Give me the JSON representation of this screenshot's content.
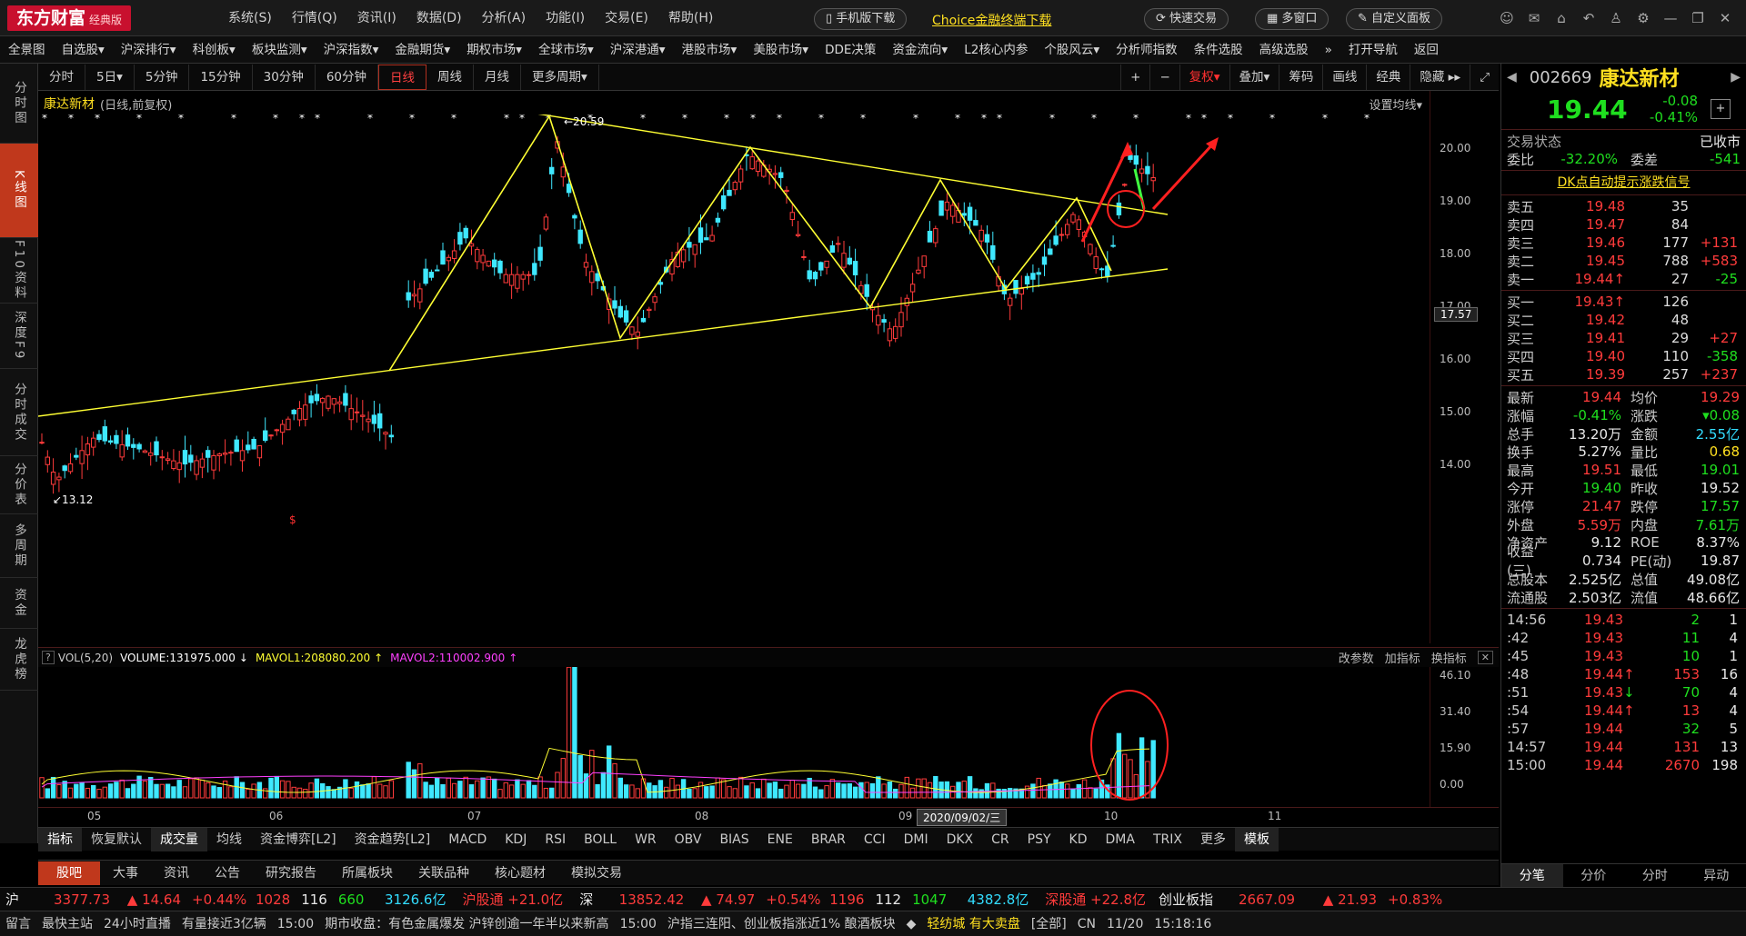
{
  "titlebar": {
    "logo": "东方财富",
    "logo_sub": "经典版",
    "menu": [
      "系统(S)",
      "行情(Q)",
      "资讯(I)",
      "数据(D)",
      "分析(A)",
      "功能(I)",
      "交易(E)",
      "帮助(H)"
    ],
    "mobile_btn": "手机版下载",
    "choice_link": "Choice金融终端下载",
    "quick_trade": "快速交易",
    "multi_window": "多窗口",
    "custom_panel": "自定义面板"
  },
  "navbar": [
    "全景图",
    "自选股▾",
    "沪深排行▾",
    "科创板▾",
    "板块监测▾",
    "沪深指数▾",
    "金融期货▾",
    "期权市场▾",
    "全球市场▾",
    "沪深港通▾",
    "港股市场▾",
    "美股市场▾",
    "DDE决策",
    "资金流向▾",
    "L2核心内参",
    "个股风云▾",
    "分析师指数",
    "条件选股",
    "高级选股",
    "»",
    "打开导航",
    "返回"
  ],
  "lefttabs": [
    {
      "label": "分时图",
      "active": false
    },
    {
      "label": "K线图",
      "active": true
    },
    {
      "label": "F10资料",
      "active": false
    },
    {
      "label": "深度F9",
      "active": false
    },
    {
      "label": "分时成交",
      "active": false
    },
    {
      "label": "分价表",
      "active": false
    },
    {
      "label": "多周期",
      "active": false
    },
    {
      "label": "资金",
      "active": false
    },
    {
      "label": "龙虎榜",
      "active": false
    }
  ],
  "periods": [
    "分时",
    "5日▾",
    "5分钟",
    "15分钟",
    "30分钟",
    "60分钟",
    "日线",
    "周线",
    "月线",
    "更多周期▾"
  ],
  "active_period": "日线",
  "toolbar_right": [
    "+",
    "−",
    "复权▾",
    "叠加▾",
    "筹码",
    "画线",
    "经典",
    "隐藏 ▸▸",
    "⤢"
  ],
  "chart": {
    "title": "康达新材",
    "subtitle": "(日线,前复权)",
    "ma_setting": "设置均线▾",
    "high_label": "20.59",
    "low_label": "13.12",
    "current_label": "17.57"
  },
  "volume_panel": {
    "indicator": "VOL(5,20)",
    "volume_text": "VOLUME:131975.000",
    "mavol1": "MAVOL1:208080.200",
    "mavol2": "MAVOL2:110002.900",
    "actions": [
      "改参数",
      "加指标",
      "换指标"
    ]
  },
  "yaxis_main": [
    "20.00",
    "19.00",
    "18.00",
    "17.00",
    "16.00",
    "15.00",
    "14.00"
  ],
  "yaxis_vol": [
    "46.10",
    "31.40",
    "15.90",
    "0.00"
  ],
  "xaxis": [
    "05",
    "06",
    "07",
    "08",
    "09",
    "10",
    "11"
  ],
  "date_cursor": "2020/09/02/三",
  "indicator_tabs": [
    "指标",
    "恢复默认",
    "成交量",
    "均线",
    "资金博弈[L2]",
    "资金趋势[L2]",
    "MACD",
    "KDJ",
    "RSI",
    "BOLL",
    "WR",
    "OBV",
    "BIAS",
    "ENE",
    "BRAR",
    "CCI",
    "DMI",
    "DKX",
    "CR",
    "PSY",
    "KD",
    "DMA",
    "TRIX",
    "更多",
    "模板"
  ],
  "bottom_tabs": [
    "股吧",
    "大事",
    "资讯",
    "公告",
    "研究报告",
    "所属板块",
    "关联品种",
    "核心题材",
    "模拟交易"
  ],
  "ticker": {
    "sh_label": "沪",
    "sh_value": "3377.73",
    "sh_change": "▲ 14.64",
    "sh_pct": "+0.44%",
    "sh_up": "1028",
    "sh_flat": "116",
    "sh_down": "660",
    "sh_amount": "3126.6亿",
    "hgt": "沪股通 +21.0亿",
    "sz_label": "深",
    "sz_value": "13852.42",
    "sz_change": "▲ 74.97",
    "sz_pct": "+0.54%",
    "sz_up": "1196",
    "sz_flat": "112",
    "sz_down": "1047",
    "sz_amount": "4382.8亿",
    "sgt": "深股通 +22.8亿",
    "cy_label": "创业板指",
    "cy_value": "2667.09",
    "cy_change": "▲ 21.93",
    "cy_pct": "+0.83%"
  },
  "newsbar": [
    "留言",
    "最快主站",
    "24小时直播",
    "有量接近3亿辆",
    "15:00",
    "期市收盘：有色金属爆发 沪锌创逾一年半以来新高",
    "15:00",
    "沪指三连阳、创业板指涨近1% 酿酒板块",
    "◆",
    "轻纺城 有大卖盘",
    "[全部]",
    "CN",
    "11/20",
    "15:18:16"
  ],
  "stock": {
    "code": "002669",
    "name": "康达新材",
    "price": "19.44",
    "change": "-0.08",
    "pct": "-0.41%",
    "trade_status_label": "交易状态",
    "trade_status": "已收市",
    "weibi_label": "委比",
    "weibi": "-32.20%",
    "weicha_label": "委差",
    "weicha": "-541",
    "dk_signal": "DK点自动提示涨跌信号"
  },
  "asks": [
    {
      "label": "卖五",
      "price": "19.48",
      "vol": "35",
      "chg": ""
    },
    {
      "label": "卖四",
      "price": "19.47",
      "vol": "84",
      "chg": ""
    },
    {
      "label": "卖三",
      "price": "19.46",
      "vol": "177",
      "chg": "+131"
    },
    {
      "label": "卖二",
      "price": "19.45",
      "vol": "788",
      "chg": "+583"
    },
    {
      "label": "卖一",
      "price": "19.44↑",
      "vol": "27",
      "chg": "-25"
    }
  ],
  "bids": [
    {
      "label": "买一",
      "price": "19.43↑",
      "vol": "126",
      "chg": ""
    },
    {
      "label": "买二",
      "price": "19.42",
      "vol": "48",
      "chg": ""
    },
    {
      "label": "买三",
      "price": "19.41",
      "vol": "29",
      "chg": "+27"
    },
    {
      "label": "买四",
      "price": "19.40",
      "vol": "110",
      "chg": "-358"
    },
    {
      "label": "买五",
      "price": "19.39",
      "vol": "257",
      "chg": "+237"
    }
  ],
  "quote": [
    {
      "l1": "最新",
      "v1": "19.44",
      "c1": "red",
      "l2": "均价",
      "v2": "19.29",
      "c2": "red"
    },
    {
      "l1": "涨幅",
      "v1": "-0.41%",
      "c1": "green",
      "l2": "涨跌",
      "v2": "▾0.08",
      "c2": "green"
    },
    {
      "l1": "总手",
      "v1": "13.20万",
      "c1": "white",
      "l2": "金额",
      "v2": "2.55亿",
      "c2": "cyan"
    },
    {
      "l1": "换手",
      "v1": "5.27%",
      "c1": "white",
      "l2": "量比",
      "v2": "0.68",
      "c2": "yellow"
    },
    {
      "l1": "最高",
      "v1": "19.51",
      "c1": "red",
      "l2": "最低",
      "v2": "19.01",
      "c2": "green"
    },
    {
      "l1": "今开",
      "v1": "19.40",
      "c1": "green",
      "l2": "昨收",
      "v2": "19.52",
      "c2": "white"
    },
    {
      "l1": "涨停",
      "v1": "21.47",
      "c1": "red",
      "l2": "跌停",
      "v2": "17.57",
      "c2": "green"
    },
    {
      "l1": "外盘",
      "v1": "5.59万",
      "c1": "red",
      "l2": "内盘",
      "v2": "7.61万",
      "c2": "green"
    },
    {
      "l1": "净资产",
      "v1": "9.12",
      "c1": "white",
      "l2": "ROE",
      "v2": "8.37%",
      "c2": "white"
    },
    {
      "l1": "收益(三)",
      "v1": "0.734",
      "c1": "white",
      "l2": "PE(动)",
      "v2": "19.87",
      "c2": "white"
    },
    {
      "l1": "总股本",
      "v1": "2.525亿",
      "c1": "white",
      "l2": "总值",
      "v2": "49.08亿",
      "c2": "white"
    },
    {
      "l1": "流通股",
      "v1": "2.503亿",
      "c1": "white",
      "l2": "流值",
      "v2": "48.66亿",
      "c2": "white"
    }
  ],
  "ticks": [
    {
      "time": "14:56",
      "price": "19.43",
      "arrow": "",
      "vol": "2",
      "n": "1",
      "pc": "red",
      "vc": "green"
    },
    {
      "time": ":42",
      "price": "19.43",
      "arrow": "",
      "vol": "11",
      "n": "4",
      "pc": "red",
      "vc": "green"
    },
    {
      "time": ":45",
      "price": "19.43",
      "arrow": "",
      "vol": "10",
      "n": "1",
      "pc": "red",
      "vc": "green"
    },
    {
      "time": ":48",
      "price": "19.44",
      "arrow": "↑",
      "vol": "153",
      "n": "16",
      "pc": "red",
      "vc": "red"
    },
    {
      "time": ":51",
      "price": "19.43",
      "arrow": "↓",
      "vol": "70",
      "n": "4",
      "pc": "red",
      "vc": "green"
    },
    {
      "time": ":54",
      "price": "19.44",
      "arrow": "↑",
      "vol": "13",
      "n": "4",
      "pc": "red",
      "vc": "red"
    },
    {
      "time": ":57",
      "price": "19.44",
      "arrow": "",
      "vol": "32",
      "n": "5",
      "pc": "red",
      "vc": "green"
    },
    {
      "time": "14:57",
      "price": "19.44",
      "arrow": "",
      "vol": "131",
      "n": "13",
      "pc": "red",
      "vc": "red"
    },
    {
      "time": "15:00",
      "price": "19.44",
      "arrow": "",
      "vol": "2670",
      "n": "198",
      "pc": "red",
      "vc": "red"
    }
  ],
  "rp_tabs": [
    "分笔",
    "分价",
    "分时",
    "异动"
  ],
  "colors": {
    "up": "#ff3b3b",
    "down": "#1fdf1f",
    "kline_up": "#ff3b3b",
    "kline_down": "#3fe8ff",
    "trend": "#ffff33",
    "accent": "#c0381c"
  }
}
